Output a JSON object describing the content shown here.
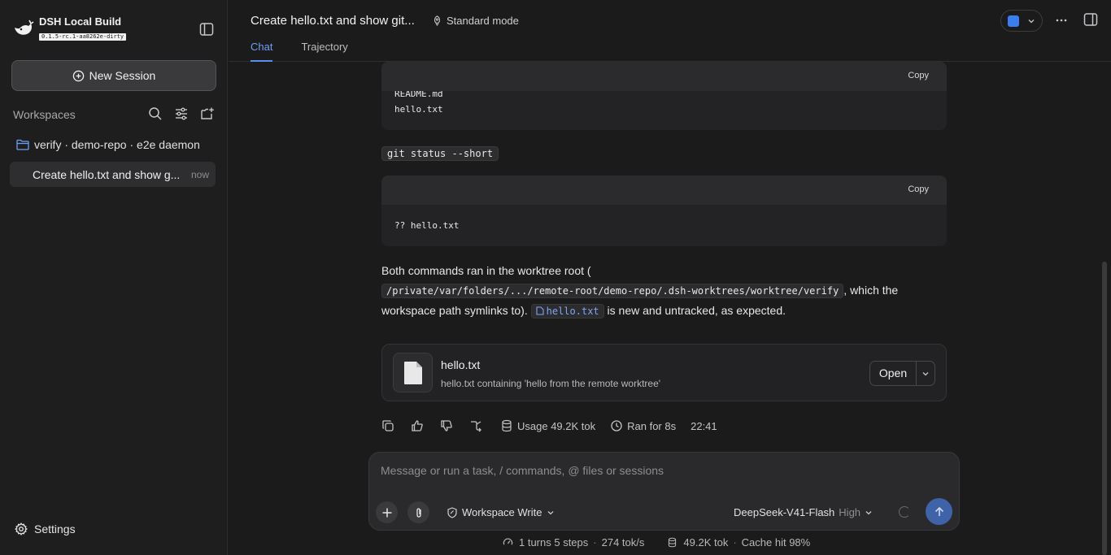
{
  "sidebar": {
    "brand_title": "DSH Local Build",
    "brand_version": "0.1.5-rc.1-aa8262e-dirty",
    "new_session_label": "New Session",
    "workspaces_label": "Workspaces",
    "workspace_name": "verify · demo-repo · e2e daemon",
    "session_title": "Create hello.txt and show g...",
    "session_time": "now",
    "settings_label": "Settings"
  },
  "header": {
    "title": "Create hello.txt and show git...",
    "mode": "Standard mode",
    "tabs": [
      {
        "label": "Chat",
        "active": true
      },
      {
        "label": "Trajectory",
        "active": false
      }
    ]
  },
  "content": {
    "block1": {
      "copy_label": "Copy",
      "lines": [
        "README.md",
        "hello.txt"
      ]
    },
    "command": "git status --short",
    "block2": {
      "copy_label": "Copy",
      "lines": [
        "?? hello.txt"
      ]
    },
    "para_start": "Both commands ran in the worktree root (",
    "para_path": "/private/var/folders/.../remote-root/demo-repo/.dsh-worktrees/worktree/verify",
    "para_mid": ", which the workspace path symlinks to).",
    "para_file": "hello.txt",
    "para_end": "is new and untracked, as expected.",
    "file_card": {
      "name": "hello.txt",
      "description": "hello.txt containing 'hello from the remote worktree'",
      "open_label": "Open"
    },
    "actions": {
      "usage": "Usage 49.2K tok",
      "ran_for": "Ran for 8s",
      "time": "22:41"
    }
  },
  "composer": {
    "placeholder": "Message or run a task, / commands, @ files or sessions",
    "permission": "Workspace Write",
    "model": "DeepSeek-V41-Flash",
    "level": "High"
  },
  "status": {
    "turns": "1 turns 5 steps",
    "speed": "274 tok/s",
    "tokens": "49.2K tok",
    "cache": "Cache hit 98%"
  },
  "colors": {
    "accent": "#5b8ef0",
    "background": "#1b1b1c",
    "sidebar": "#1e1e1f"
  }
}
